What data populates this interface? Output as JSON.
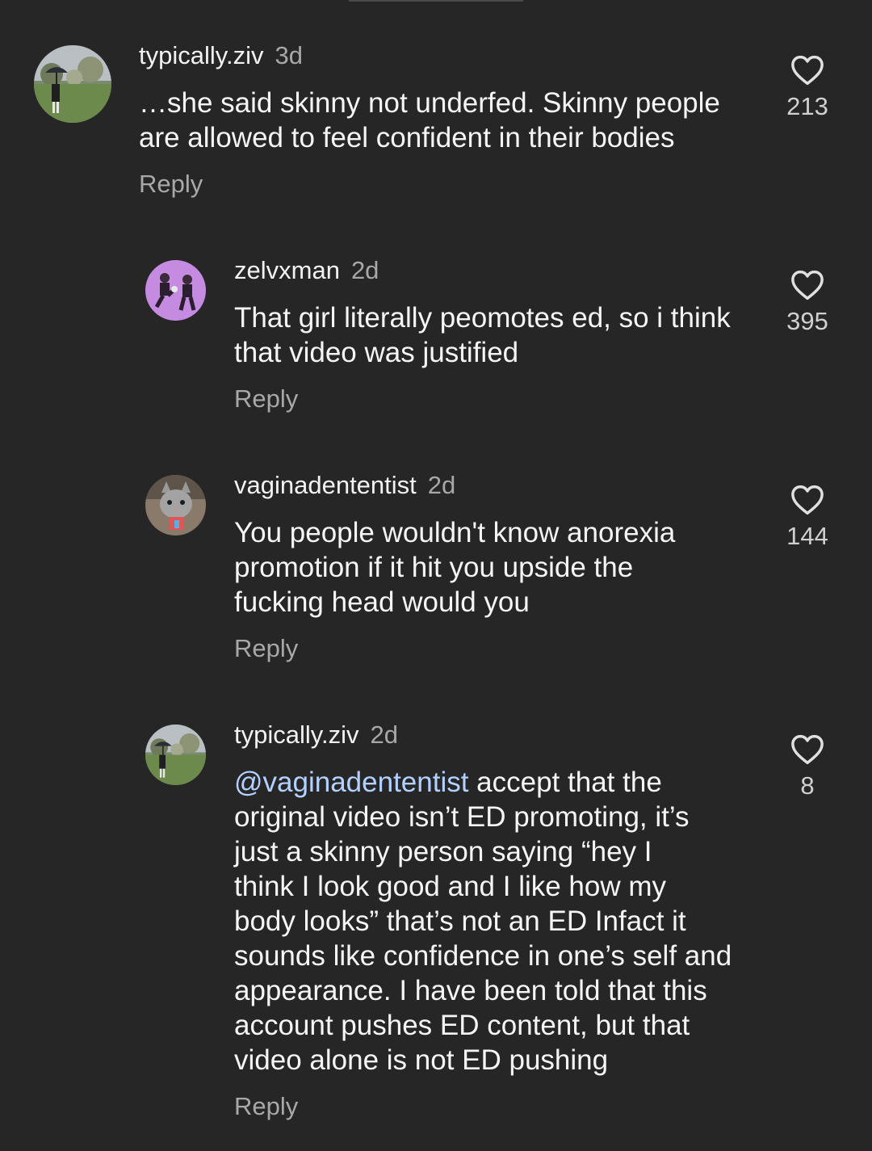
{
  "comments": [
    {
      "username": "typically.ziv",
      "age": "3d",
      "text": "…she said skinny not underfed. Skinny people\nare allowed to feel confident in their bodies",
      "reply_label": "Reply",
      "likes": "213",
      "avatar_icon": "park-umbrella-avatar"
    },
    {
      "username": "zelvxman",
      "age": "2d",
      "text": "That girl literally peomotes ed, so i think\nthat video was justified",
      "reply_label": "Reply",
      "likes": "395",
      "avatar_icon": "fighters-avatar"
    },
    {
      "username": "vaginadententist",
      "age": "2d",
      "text": "You people wouldn't know anorexia\npromotion if it hit you upside the\nfucking head would you",
      "reply_label": "Reply",
      "likes": "144",
      "avatar_icon": "cat-avatar"
    },
    {
      "username": "typically.ziv",
      "age": "2d",
      "mention": "@vaginadententist",
      "text": " accept that the\noriginal video isn’t ED promoting, it’s\njust a skinny person saying “hey I\nthink I look good and I like how my\nbody looks” that’s not an ED Infact it\nsounds like confidence in one’s self and\nappearance. I have been told that this\naccount pushes ED content, but that\nvideo alone is not ED pushing",
      "reply_label": "Reply",
      "likes": "8",
      "avatar_icon": "park-umbrella-avatar"
    }
  ],
  "colors": {
    "background": "#262626",
    "text_primary": "#f5f5f5",
    "text_secondary": "#a8a8a8",
    "mention": "#b3d1ff",
    "heart_outline": "#e0e0e0"
  },
  "icons": {
    "like": "heart-outline-icon"
  }
}
